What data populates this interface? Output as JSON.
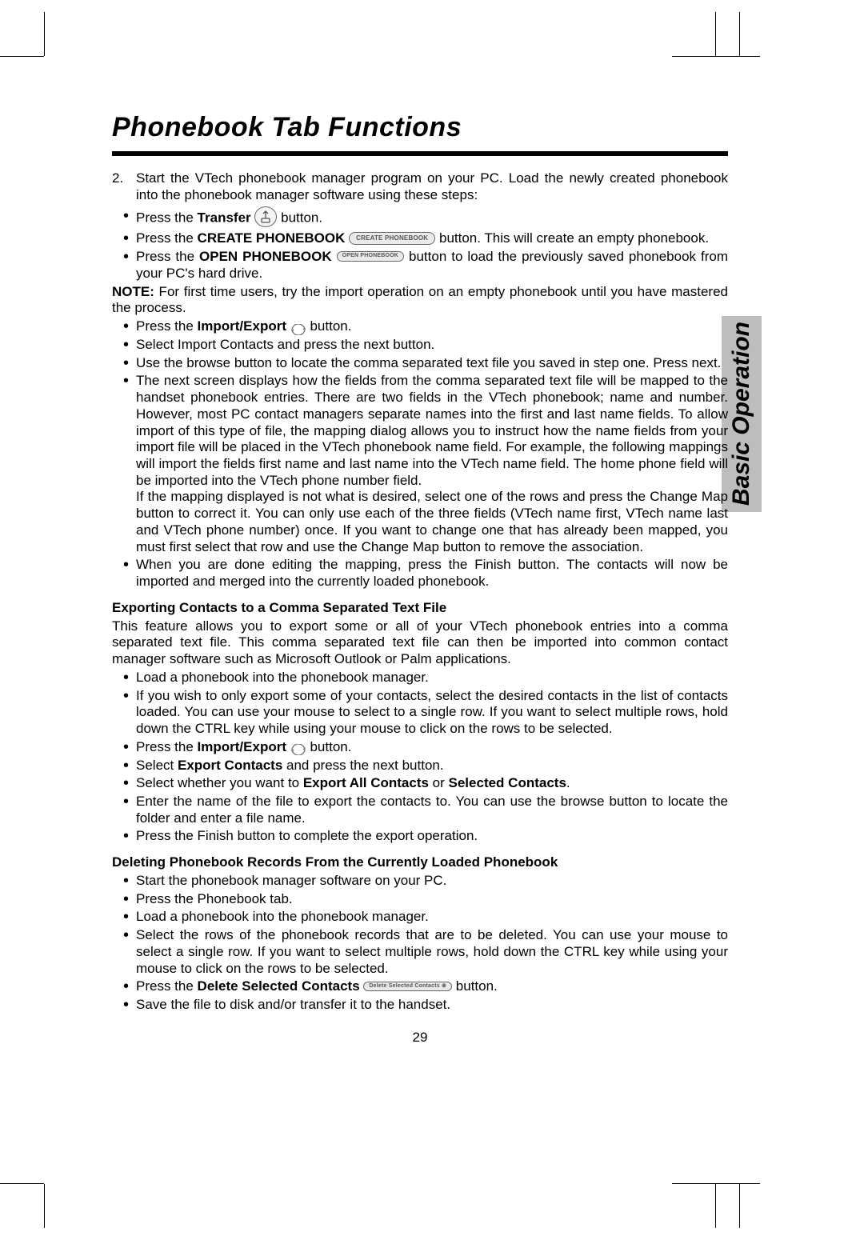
{
  "title": "Phonebook Tab Functions",
  "side_tab": "Basic Operation",
  "page_number": "29",
  "step2": "Start the VTech phonebook manager program on your PC. Load the newly created phonebook into the phonebook manager software using these steps:",
  "step2_num": "2.",
  "bul_transfer_a": "Press the ",
  "bul_transfer_b": "Transfer",
  "bul_transfer_c": " button.",
  "bul_create_a": "Press the ",
  "bul_create_b": "CREATE PHONEBOOK",
  "bul_create_btn": "CREATE PHONEBOOK",
  "bul_create_c": " button. This will create an empty phonebook.",
  "bul_open_a": "Press the ",
  "bul_open_b": "OPEN PHONEBOOK",
  "bul_open_btn": "OPEN PHONEBOOK",
  "bul_open_c": " button to load the previously saved phonebook from your PC's hard drive.",
  "note_label": "NOTE:",
  "note_text": " For first time users, try the import operation on an empty phonebook until you have mastered the process.",
  "bul_ie_a": "Press the ",
  "bul_ie_b": "Import/Export",
  "bul_ie_c": " button.",
  "bul_sel_import": "Select Import Contacts and press the next button.",
  "bul_browse": "Use the browse button to locate the comma separated text file you saved in step one. Press next.",
  "bul_mapping": "The next screen displays how the fields from the comma separated text file will be mapped to the handset phonebook entries. There are two fields in the VTech phonebook; name and number. However, most PC contact managers separate names into the first and last name fields. To allow import of this type of file, the mapping dialog allows you to instruct how the name fields from your import file will be placed in the VTech phonebook name field. For example, the following mappings will import the fields first name and last name into the VTech name field. The home phone field will be imported into the VTech phone number field.",
  "bul_mapping_sub": "If the mapping displayed is not what is desired, select one of the rows and press the Change Map button to correct it. You can only use each of the three fields (VTech name first, VTech name last and VTech phone number) once. If you want to change one that has already been mapped, you must first select that row and use the Change Map button to remove the association.",
  "bul_finish": "When you are done editing the mapping, press the Finish button. The contacts will now be imported and merged into the currently loaded phonebook.",
  "export_heading": "Exporting Contacts to a Comma Separated Text File",
  "export_para": "This feature allows you to export some or all of your VTech phonebook entries into a comma separated text file. This comma separated text file can then be imported into common contact manager software such as Microsoft Outlook or Palm applications.",
  "exp_b1": "Load a phonebook into the phonebook manager.",
  "exp_b2": "If you wish to only export some of your contacts, select the desired contacts in the list of contacts loaded. You can use your mouse to select to a single row. If you want to select multiple rows, hold down the CTRL key while using your mouse to click on the rows to be selected.",
  "exp_b3a": "Press the ",
  "exp_b3b": "Import/Export",
  "exp_b3c": " button.",
  "exp_b4a": "Select ",
  "exp_b4b": "Export Contacts",
  "exp_b4c": " and press the next button.",
  "exp_b5a": "Select whether you want to ",
  "exp_b5b": "Export All Contacts",
  "exp_b5c": " or ",
  "exp_b5d": "Selected Contacts",
  "exp_b5e": ".",
  "exp_b6": "Enter the name of the file to export the contacts to. You can use the browse button to locate the folder and enter a file name.",
  "exp_b7": "Press the Finish button to complete the export operation.",
  "del_heading": "Deleting Phonebook Records From the Currently Loaded Phonebook",
  "del_b1": "Start the phonebook manager software on your PC.",
  "del_b2": "Press the Phonebook tab.",
  "del_b3": "Load a phonebook into the phonebook manager.",
  "del_b4": "Select the rows of the phonebook records that are to be deleted. You can use your mouse to select a single row. If you want to select multiple rows, hold down the CTRL key while using your mouse to click on the rows to be selected.",
  "del_b5a": "Press the ",
  "del_b5b": "Delete Selected Contacts",
  "del_b5btn": "Delete Selected Contacts  ⊗",
  "del_b5c": " button.",
  "del_b6": "Save the file to disk and/or transfer it to the handset."
}
